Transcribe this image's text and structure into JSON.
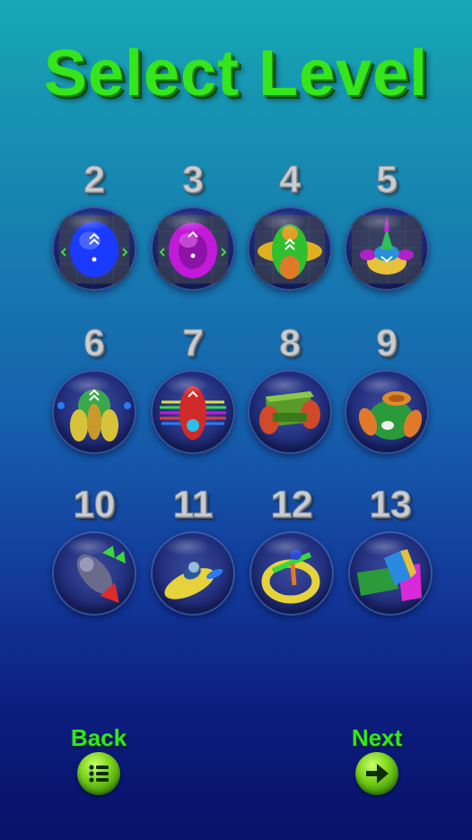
{
  "screen": {
    "title": "Select Level"
  },
  "levels": [
    {
      "number": "2",
      "icon": "blue-egg-ship-icon"
    },
    {
      "number": "3",
      "icon": "magenta-egg-ship-icon"
    },
    {
      "number": "4",
      "icon": "green-winged-ship-icon"
    },
    {
      "number": "5",
      "icon": "yellow-saucer-ship-icon"
    },
    {
      "number": "6",
      "icon": "green-tripod-ship-icon"
    },
    {
      "number": "7",
      "icon": "red-striped-ship-icon"
    },
    {
      "number": "8",
      "icon": "green-roller-ship-icon"
    },
    {
      "number": "9",
      "icon": "green-orange-pod-ship-icon"
    },
    {
      "number": "10",
      "icon": "rocket-ship-icon"
    },
    {
      "number": "11",
      "icon": "yellow-jet-ship-icon"
    },
    {
      "number": "12",
      "icon": "ring-ship-icon"
    },
    {
      "number": "13",
      "icon": "block-ship-icon"
    }
  ],
  "navigation": {
    "back_label": "Back",
    "back_icon": "menu-list-icon",
    "next_label": "Next",
    "next_icon": "arrow-right-icon"
  },
  "colors": {
    "title_green": "#35e61b",
    "nav_green": "#7bd41a",
    "background_top": "#16aab4",
    "background_bottom": "#08126a",
    "level_number_silver": "#c9ccd0"
  }
}
